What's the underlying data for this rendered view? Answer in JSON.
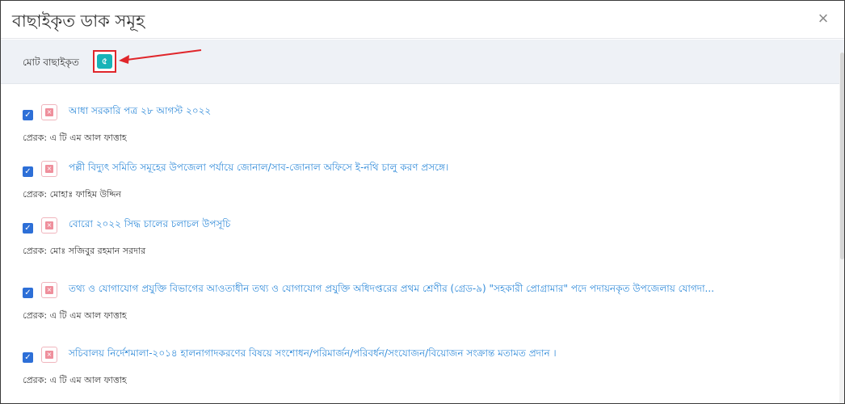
{
  "dialog": {
    "title": "বাছাইকৃত ডাক সমূহ",
    "close_icon": "close-icon",
    "close_glyph": "×"
  },
  "summary": {
    "label": "মোট বাছাইকৃত",
    "count": "৫",
    "badge_color": "#17b3b8",
    "highlight_color": "#e0262b"
  },
  "items": [
    {
      "checked": true,
      "title": "আধা সরকারি পত্র ২৮ আগস্ট ২০২২",
      "sender": "প্রেরক: এ টি এম আল ফাত্তাহ"
    },
    {
      "checked": true,
      "title": "পল্লী বিদ্যুৎ সমিতি সমূহের উপজেলা পর্যায়ে জোনাল/সাব-জোনাল অফিসে ই-নথি চালু করণ প্রসঙ্গে।",
      "sender": "প্রেরক: মোহাঃ ফাহিম উদ্দিন"
    },
    {
      "checked": true,
      "title": "বোরো ২০২২ সিদ্ধ চালের চলাচল উপসূচি",
      "sender": "প্রেরক: মোঃ সজিবুর রহমান সরদার"
    },
    {
      "checked": true,
      "title": "তথ্য ও যোগাযোগ প্রযুক্তি বিভাগের আওতাধীন তথ্য ও যোগাযোগ প্রযুক্তি অধিদপ্তরের প্রথম শ্রেণীর (গ্রেড-৯) \"সহকারী প্রোগ্রামার\" পদে পদায়নকৃত উপজেলায় যোগদা...",
      "sender": "প্রেরক: এ টি এম আল ফাত্তাহ"
    },
    {
      "checked": true,
      "title": "সচিবালয় নির্দেশমালা-২০১৪ হালনাগাদকরণের বিষয়ে সংশোধন/পরিমার্জন/পরিবর্ধন/সংযোজন/বিয়োজন সংক্রান্ত মতামত প্রদান ।",
      "sender": "প্রেরক: এ টি এম আল ফাত্তাহ"
    }
  ],
  "theme": {
    "link_color": "#2f8ad9",
    "checkbox_color": "#2d6fd7",
    "remove_icon_color": "#ef8f9c",
    "summary_bg": "#eef1f6"
  }
}
